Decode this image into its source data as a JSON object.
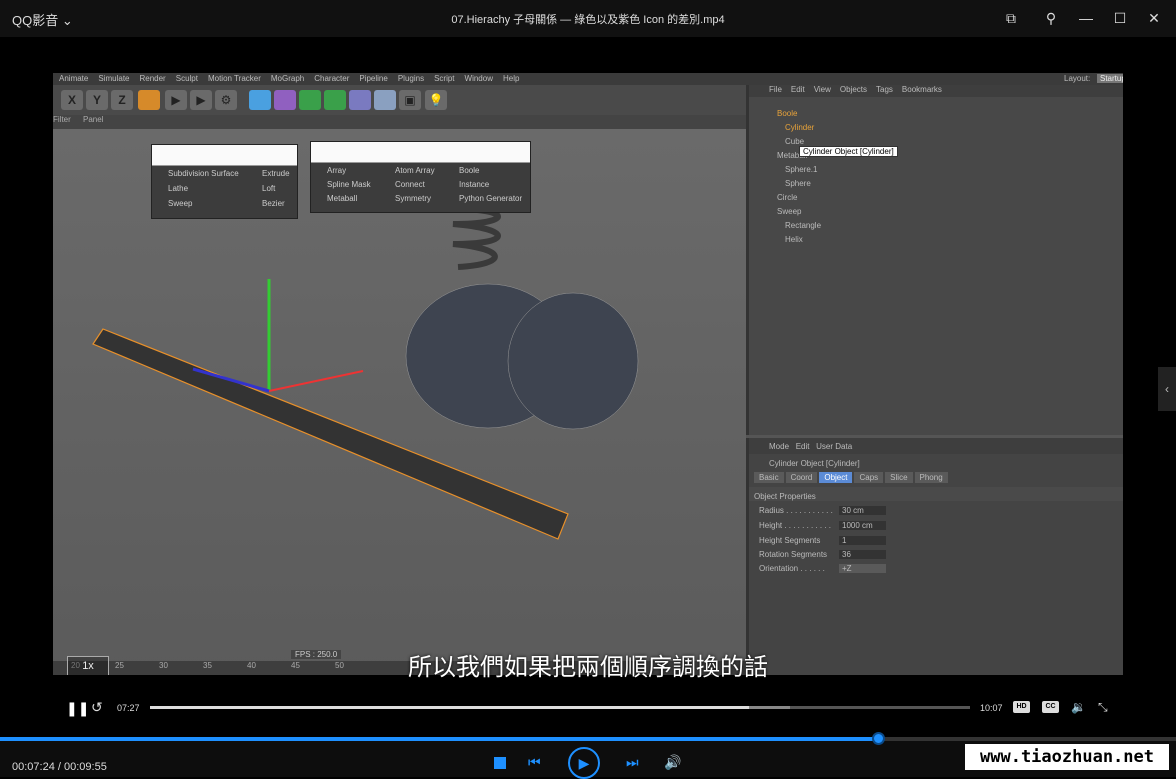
{
  "titlebar": {
    "app_name": "QQ影音",
    "title": "07.Hierachy 子母關係 — 綠色以及紫色 Icon 的差別.mp4"
  },
  "c4d": {
    "menu": [
      "Animate",
      "Simulate",
      "Render",
      "Sculpt",
      "Motion Tracker",
      "MoGraph",
      "Character",
      "Pipeline",
      "Plugins",
      "Script",
      "Window",
      "Help"
    ],
    "layout_label": "Layout:",
    "layout_value": "Startup",
    "tools": [
      "X",
      "Y",
      "Z"
    ],
    "vp_header": [
      "Filter",
      "Panel"
    ],
    "popup1": [
      "Subdivision Surface",
      "Extrude",
      "Lathe",
      "Loft",
      "Sweep",
      "Bezier"
    ],
    "popup2": [
      "Array",
      "Atom Array",
      "Boole",
      "Spline Mask",
      "Connect",
      "Instance",
      "Metaball",
      "Symmetry",
      "Python Generator"
    ],
    "om_menu": [
      "File",
      "Edit",
      "View",
      "Objects",
      "Tags",
      "Bookmarks"
    ],
    "objects": [
      "Boole",
      "Cylinder",
      "Cube",
      "Metaball",
      "Sphere.1",
      "Sphere",
      "Circle",
      "Sweep",
      "Rectangle",
      "Helix"
    ],
    "tooltip": "Cylinder Object [Cylinder]",
    "attr_menu": [
      "Mode",
      "Edit",
      "User Data"
    ],
    "attr_title": "Cylinder Object [Cylinder]",
    "attr_tabs": [
      "Basic",
      "Coord",
      "Object",
      "Caps",
      "Slice",
      "Phong"
    ],
    "section": "Object Properties",
    "props": [
      {
        "label": "Radius . . . . . . . . . . .",
        "value": "30 cm"
      },
      {
        "label": "Height . . . . . . . . . . .",
        "value": "1000 cm"
      },
      {
        "label": "Height Segments",
        "value": "1"
      },
      {
        "label": "Rotation Segments",
        "value": "36"
      },
      {
        "label": "Orientation . . . . . .",
        "value": "+Z"
      }
    ],
    "fps": "FPS : 250.0",
    "ruler": [
      "20",
      "25",
      "30",
      "35",
      "40",
      "45",
      "50"
    ],
    "speed": "1x"
  },
  "subtitle": "所以我們如果把兩個順序調換的話",
  "player": {
    "current": "07:27",
    "total": "10:07",
    "progress": 0.73,
    "buffered": 0.78,
    "hd": "HD",
    "cc": "CC"
  },
  "bottom": {
    "time": "00:07:24 / 00:09:55",
    "progress": 0.747
  },
  "watermark": "www.tiaozhuan.net",
  "colors": {
    "accent": "#1e90ff",
    "selected": "#e8a33a"
  }
}
